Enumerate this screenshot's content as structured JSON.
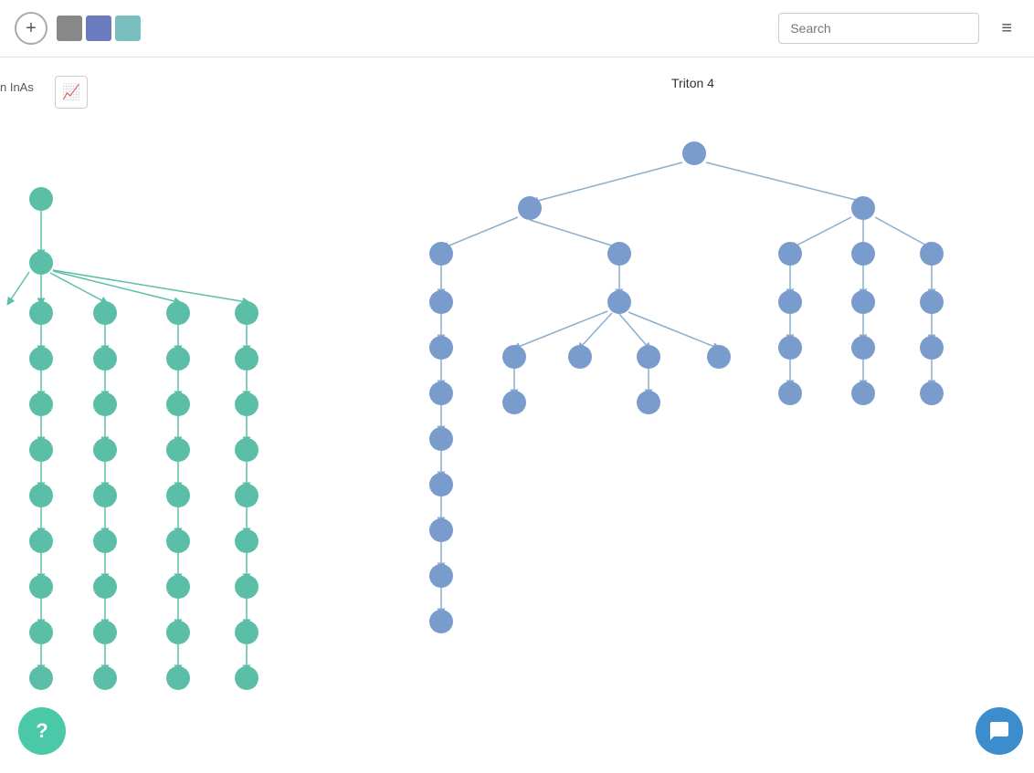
{
  "header": {
    "add_button_label": "+",
    "swatches": [
      {
        "color": "#888888"
      },
      {
        "color": "#6b7bbf"
      },
      {
        "color": "#7abfbf"
      }
    ],
    "search_placeholder": "Search",
    "menu_icon": "≡"
  },
  "canvas": {
    "chart_button_icon": "📈",
    "left_label": "n InAs",
    "triton_label": "Triton 4",
    "help_label": "?",
    "chat_icon": "💬"
  },
  "colors": {
    "green_node": "#5bbfa8",
    "blue_node": "#7a9ccc",
    "arrow": "#8aaecc"
  }
}
